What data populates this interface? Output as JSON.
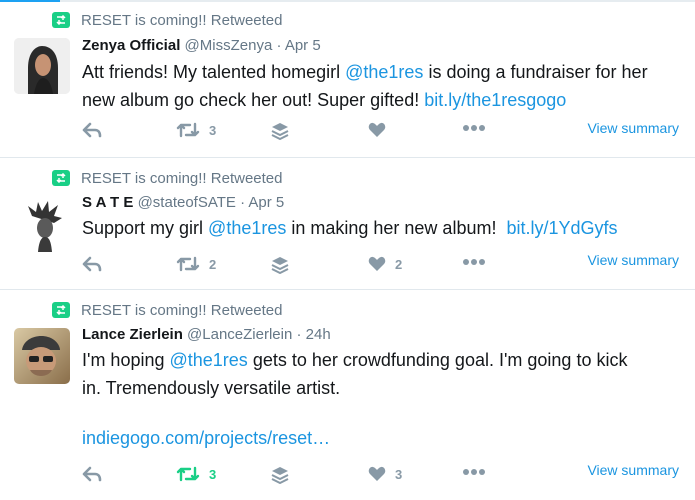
{
  "retweet_context": "RESET is coming!! Retweeted",
  "tweets": [
    {
      "name": "Zenya Official",
      "handle": "@MissZenya",
      "separator": "·",
      "date": "Apr 5",
      "text_line1_a": "Att friends! My talented homegirl ",
      "mention": "@the1res",
      "text_line1_b": " is doing a fundraiser for her",
      "text_line2_a": "new album go check her out! Super gifted! ",
      "link": "bit.ly/the1resgogo",
      "retweets": "3",
      "likes": "",
      "summary": "View summary"
    },
    {
      "name": "S A T E",
      "handle": "@stateofSATE",
      "separator": "·",
      "date": "Apr 5",
      "text_a": "Support my girl ",
      "mention": "@the1res",
      "text_b": " in making her new album!  ",
      "link": "bit.ly/1YdGyfs",
      "retweets": "2",
      "likes": "2",
      "summary": "View summary"
    },
    {
      "name": "Lance Zierlein",
      "handle": "@LanceZierlein",
      "separator": "·",
      "date": "24h",
      "text_a": "I'm hoping ",
      "mention": "@the1res",
      "text_b": " gets to her crowdfunding goal. I'm going to kick",
      "text_line2": "in. Tremendously versatile artist.",
      "link": "indiegogo.com/projects/reset…",
      "retweets": "3",
      "likes": "3",
      "summary": "View summary"
    }
  ],
  "colors": {
    "retweet_green": "#19cf86",
    "link_blue": "#1b95e0",
    "icon_gray": "#8899a6",
    "meta_gray": "#657786"
  }
}
